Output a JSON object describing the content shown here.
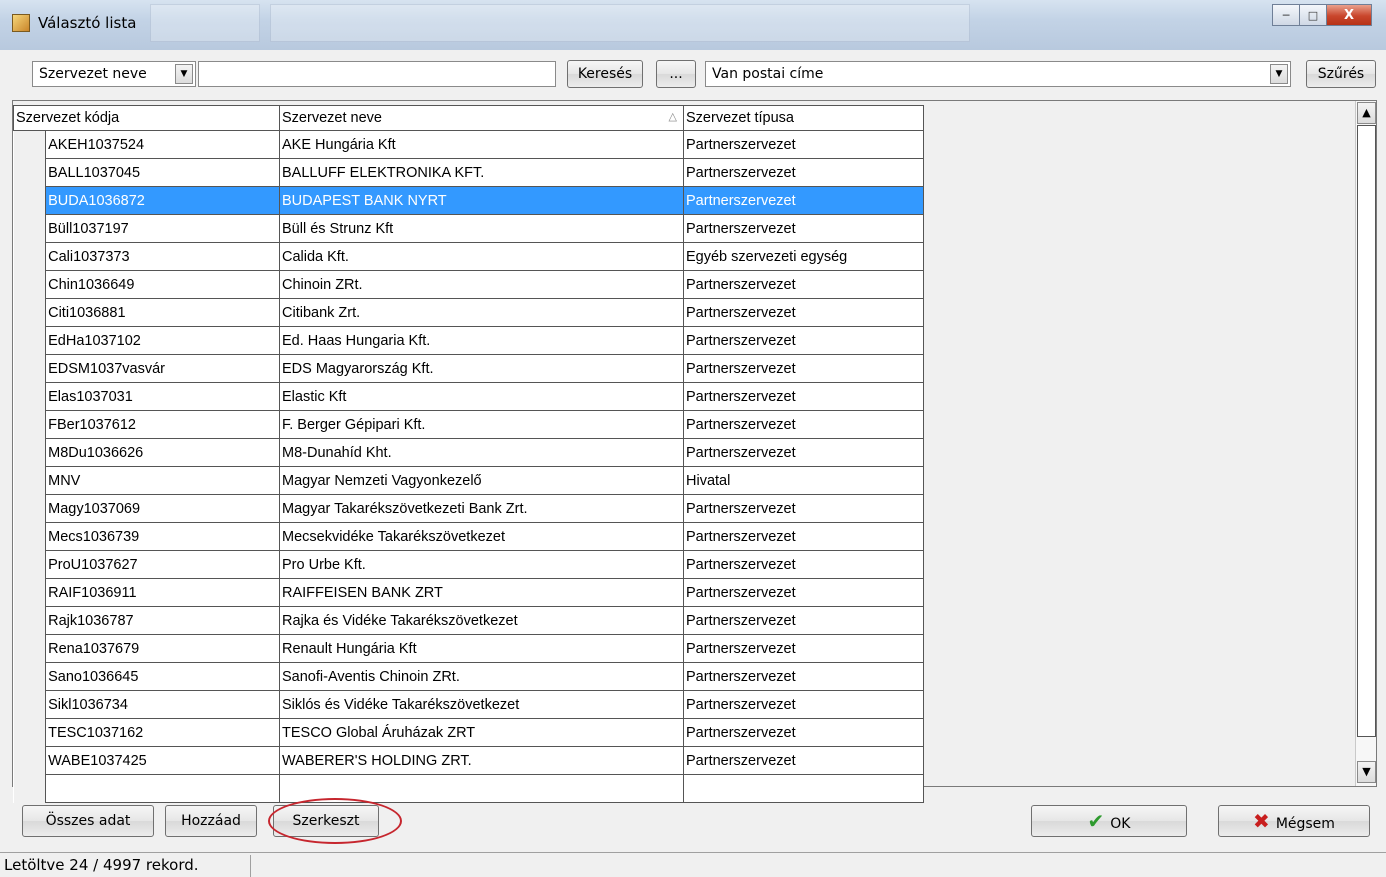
{
  "window": {
    "title": "Választó lista",
    "min_glyph": "─",
    "max_glyph": "□",
    "close_glyph": "X"
  },
  "toolbar": {
    "field_select": "Szervezet neve",
    "search_value": "",
    "search_button": "Keresés",
    "more_button": "...",
    "filter_select": "Van postai címe",
    "filter_button": "Szűrés"
  },
  "grid": {
    "columns": [
      "Szervezet kódja",
      "Szervezet neve",
      "Szervezet típusa"
    ],
    "sorted_column": 1,
    "sort_indicator": "△",
    "selected_row": 2,
    "rows": [
      [
        "AKEH1037524",
        "AKE Hungária Kft",
        "Partnerszervezet"
      ],
      [
        "BALL1037045",
        "BALLUFF ELEKTRONIKA KFT.",
        "Partnerszervezet"
      ],
      [
        "BUDA1036872",
        "BUDAPEST BANK NYRT",
        "Partnerszervezet"
      ],
      [
        "Büll1037197",
        "Büll és Strunz Kft",
        "Partnerszervezet"
      ],
      [
        "Cali1037373",
        "Calida Kft.",
        "Egyéb szervezeti egység"
      ],
      [
        "Chin1036649",
        "Chinoin ZRt.",
        "Partnerszervezet"
      ],
      [
        "Citi1036881",
        "Citibank Zrt.",
        "Partnerszervezet"
      ],
      [
        "EdHa1037102",
        "Ed. Haas Hungaria Kft.",
        "Partnerszervezet"
      ],
      [
        "EDSM1037vasvár",
        "EDS Magyarország Kft.",
        "Partnerszervezet"
      ],
      [
        "Elas1037031",
        "Elastic Kft",
        "Partnerszervezet"
      ],
      [
        "FBer1037612",
        "F. Berger Gépipari Kft.",
        "Partnerszervezet"
      ],
      [
        "M8Du1036626",
        "M8-Dunahíd Kht.",
        "Partnerszervezet"
      ],
      [
        "MNV",
        "Magyar Nemzeti Vagyonkezelő",
        "Hivatal"
      ],
      [
        "Magy1037069",
        "Magyar Takarékszövetkezeti Bank Zrt.",
        "Partnerszervezet"
      ],
      [
        "Mecs1036739",
        "Mecsekvidéke Takarékszövetkezet",
        "Partnerszervezet"
      ],
      [
        "ProU1037627",
        "Pro Urbe Kft.",
        "Partnerszervezet"
      ],
      [
        "RAIF1036911",
        "RAIFFEISEN BANK  ZRT",
        "Partnerszervezet"
      ],
      [
        "Rajk1036787",
        "Rajka és Vidéke Takarékszövetkezet",
        "Partnerszervezet"
      ],
      [
        "Rena1037679",
        "Renault Hungária Kft",
        "Partnerszervezet"
      ],
      [
        "Sano1036645",
        "Sanofi-Aventis Chinoin ZRt.",
        "Partnerszervezet"
      ],
      [
        "Sikl1036734",
        "Siklós és Vidéke Takarékszövetkezet",
        "Partnerszervezet"
      ],
      [
        "TESC1037162",
        "TESCO Global Áruházak ZRT",
        "Partnerszervezet"
      ],
      [
        "WABE1037425",
        "WABERER'S HOLDING ZRT.",
        "Partnerszervezet"
      ]
    ]
  },
  "bottom": {
    "all_data": "Összes adat",
    "add": "Hozzáad",
    "edit": "Szerkeszt",
    "ok": "OK",
    "cancel": "Mégsem"
  },
  "status": {
    "text": "Letöltve 24 / 4997 rekord."
  },
  "colors": {
    "selection": "#3399ff",
    "highlight_ellipse": "#c6262e"
  }
}
